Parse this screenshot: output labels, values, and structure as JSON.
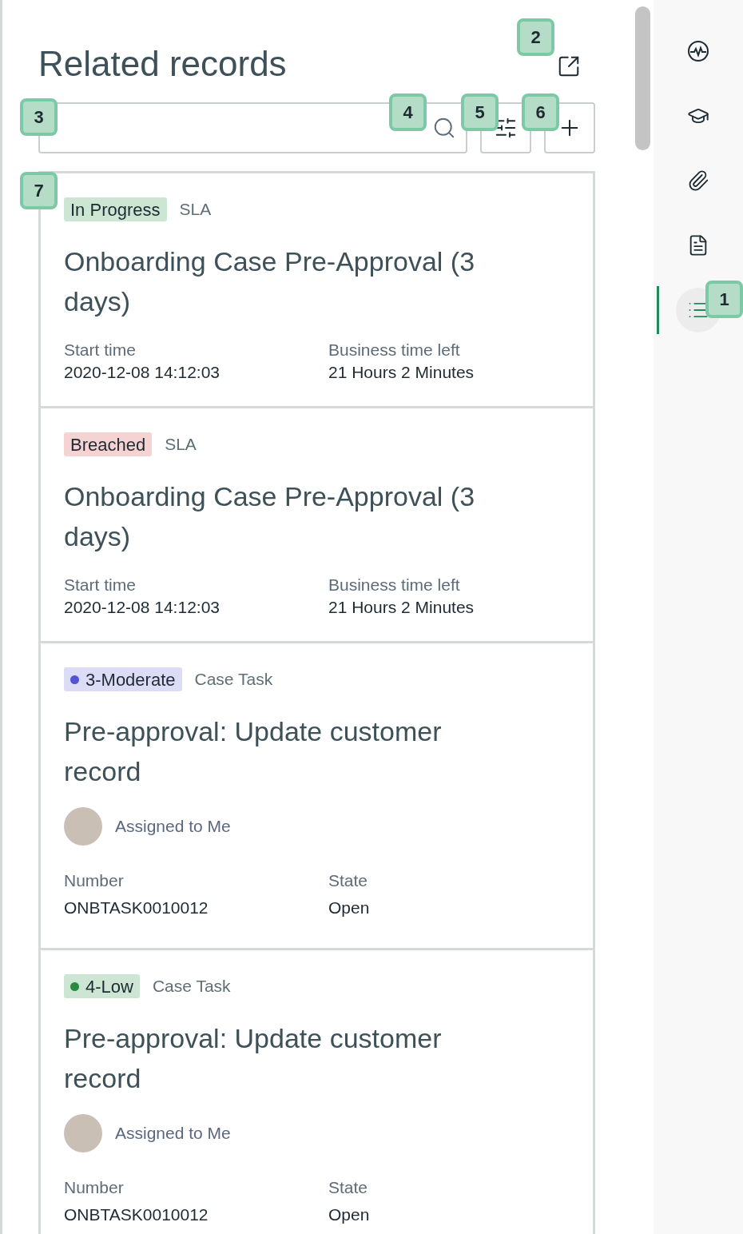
{
  "panel": {
    "title": "Related records"
  },
  "records": [
    {
      "tag": {
        "kind": "status",
        "label": "In Progress",
        "color": "#cde6d4"
      },
      "type": "SLA",
      "title": "Onboarding Case Pre-Approval (3 days)",
      "fields": [
        {
          "label": "Start time",
          "value": "2020-12-08 14:12:03"
        },
        {
          "label": "Business time left",
          "value": "21 Hours 2 Minutes"
        }
      ]
    },
    {
      "tag": {
        "kind": "status",
        "label": "Breached",
        "color": "#f5d3d3"
      },
      "type": "SLA",
      "title": "Onboarding Case Pre-Approval (3 days)",
      "fields": [
        {
          "label": "Start time",
          "value": "2020-12-08 14:12:03"
        },
        {
          "label": "Business time left",
          "value": "21 Hours 2 Minutes"
        }
      ]
    },
    {
      "tag": {
        "kind": "priority",
        "label": "3-Moderate",
        "color": "#dcdcf7",
        "dot": {
          "color": "#5353d6"
        }
      },
      "type": "Case Task",
      "title": "Pre-approval: Update customer record",
      "assignee": "Assigned to Me",
      "fields": [
        {
          "label": "Number",
          "value": "ONBTASK0010012"
        },
        {
          "label": "State",
          "value": "Open"
        }
      ]
    },
    {
      "tag": {
        "kind": "priority",
        "label": "4-Low",
        "color": "#cde6d4",
        "dot": {
          "color": "#2a8a3e"
        }
      },
      "type": "Case Task",
      "title": "Pre-approval: Update customer record",
      "assignee": "Assigned to Me",
      "fields": [
        {
          "label": "Number",
          "value": "ONBTASK0010012"
        },
        {
          "label": "State",
          "value": "Open"
        }
      ]
    }
  ],
  "sidebar": {
    "items": [
      {
        "kind": "activity",
        "selected": false
      },
      {
        "kind": "learning",
        "selected": false
      },
      {
        "kind": "attachments",
        "selected": false
      },
      {
        "kind": "document",
        "selected": false
      },
      {
        "kind": "list",
        "selected": true
      }
    ]
  },
  "callouts": [
    "1",
    "2",
    "3",
    "4",
    "5",
    "6",
    "7"
  ]
}
